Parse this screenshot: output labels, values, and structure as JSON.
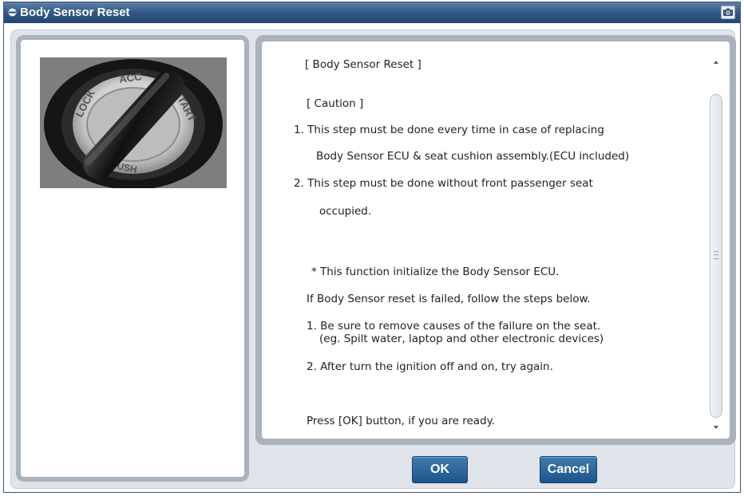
{
  "window": {
    "title": "Body Sensor Reset"
  },
  "image": {
    "ring_labels": [
      "LOCK",
      "ACC",
      "START",
      "PUSH"
    ]
  },
  "content": {
    "lines": [
      "[ Body Sensor Reset ]",
      "[ Caution ]",
      "1. This step must be done every time in case of replacing",
      "Body Sensor ECU & seat cushion assembly.(ECU included)",
      "2. This step must be done without front passenger seat",
      "occupied.",
      "* This function initialize the Body Sensor ECU.",
      "If Body Sensor reset is failed, follow the steps below.",
      "1. Be sure to remove causes of the failure on the seat.",
      "(eg. Spilt water, laptop and other electronic devices)",
      "2. After turn the ignition off and on, try again.",
      "Press [OK] button, if you are ready."
    ]
  },
  "buttons": {
    "ok": "OK",
    "cancel": "Cancel"
  },
  "colors": {
    "titlebar": "#2f5583",
    "button": "#1d5589",
    "panel_border": "#aab2be"
  }
}
